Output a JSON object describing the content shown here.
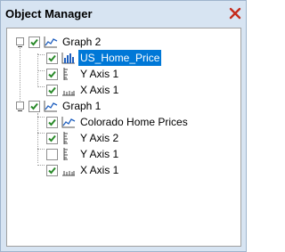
{
  "window": {
    "title": "Object Manager",
    "close_icon": "close-icon"
  },
  "tree": [
    {
      "label": "Graph 2",
      "icon": "line-chart-icon",
      "checked": true,
      "expanded": true,
      "children": [
        {
          "label": "US_Home_Price",
          "icon": "bar-chart-icon",
          "checked": true,
          "selected": true
        },
        {
          "label": "Y Axis 1",
          "icon": "y-axis-icon",
          "checked": true
        },
        {
          "label": "X Axis 1",
          "icon": "x-axis-icon",
          "checked": true
        }
      ]
    },
    {
      "label": "Graph 1",
      "icon": "line-chart-icon",
      "checked": true,
      "expanded": true,
      "children": [
        {
          "label": "Colorado Home Prices",
          "icon": "line-chart-icon",
          "checked": true
        },
        {
          "label": "Y Axis 2",
          "icon": "y-axis-icon",
          "checked": true
        },
        {
          "label": "Y Axis 1",
          "icon": "y-axis-icon",
          "checked": false
        },
        {
          "label": "X Axis 1",
          "icon": "x-axis-icon",
          "checked": true
        }
      ]
    }
  ],
  "colors": {
    "frame": "#d7e4f2",
    "check_green": "#2a8a2a",
    "selection": "#0078d7",
    "close_red": "#c42b1c"
  }
}
